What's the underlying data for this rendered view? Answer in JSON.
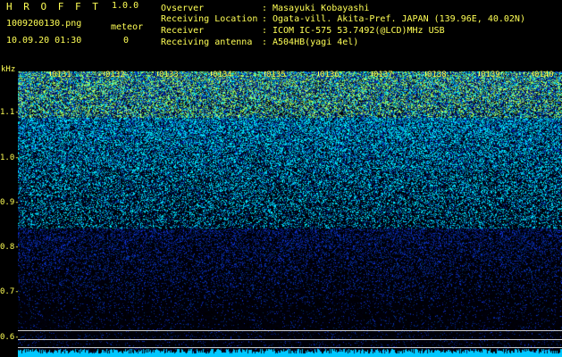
{
  "app": {
    "title": "H R O F F T",
    "version": "1.0.0"
  },
  "file": {
    "name": "1009200130.png",
    "datetime": "10.09.20 01:30"
  },
  "meteor": {
    "label": "meteor",
    "count": "0"
  },
  "metadata": [
    {
      "label": "Ovserver",
      "colon": ":",
      "value": "Masayuki Kobayashi"
    },
    {
      "label": "Receiving Location",
      "colon": ":",
      "value": "Ogata-vill. Akita-Pref. JAPAN (139.96E, 40.02N)"
    },
    {
      "label": "Receiver",
      "colon": ":",
      "value": "ICOM IC-575 53.7492(@LCD)MHz USB"
    },
    {
      "label": "Receiving antenna",
      "colon": ":",
      "value": "A504HB(yagi 4el)"
    }
  ],
  "spectrogram": {
    "unit": "kHz",
    "y_ticks": [
      {
        "label": "1.1-",
        "value": 1.1
      },
      {
        "label": "1.0-",
        "value": 1.0
      },
      {
        "label": "0.9-",
        "value": 0.9
      },
      {
        "label": "0.8-",
        "value": 0.8
      },
      {
        "label": "0.7-",
        "value": 0.7
      },
      {
        "label": "0.6-",
        "value": 0.6
      }
    ],
    "time_labels": [
      "0131",
      "0132",
      "0133",
      "0134",
      "0135",
      "0136",
      "0137",
      "0138",
      "0139",
      "0140"
    ],
    "colors": {
      "background": "#000000",
      "accent_yellow": "#ffff55",
      "noise_high": "#9cff5a",
      "noise_mid": "#00d5ff",
      "noise_low": "#0f2bbd",
      "baseline": "#00c8ff",
      "marker_line": "#d8d8d8"
    }
  }
}
